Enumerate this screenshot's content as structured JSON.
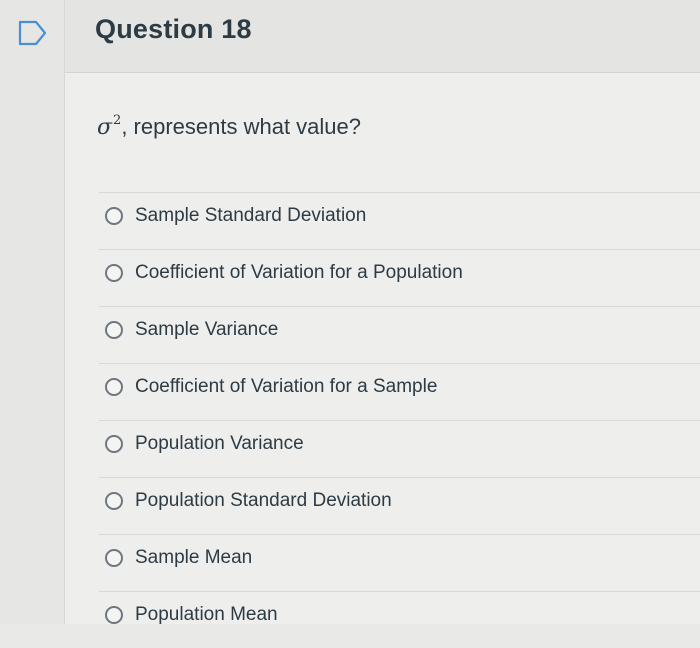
{
  "question": {
    "title": "Question 18",
    "prompt_symbol": "σ",
    "prompt_exponent": "2",
    "prompt_text": ", represents what value?",
    "flag_icon": "flag-question-icon"
  },
  "answers": [
    {
      "label": "Sample Standard Deviation"
    },
    {
      "label": "Coefficient of Variation for a Population"
    },
    {
      "label": "Sample Variance"
    },
    {
      "label": "Coefficient of Variation for a Sample"
    },
    {
      "label": "Population Variance"
    },
    {
      "label": "Population Standard Deviation"
    },
    {
      "label": "Sample Mean"
    },
    {
      "label": "Population Mean"
    }
  ],
  "colors": {
    "text": "#2d3b45",
    "background": "#eeeeec",
    "header": "#e4e4e2",
    "radio_border": "#6e7780"
  }
}
